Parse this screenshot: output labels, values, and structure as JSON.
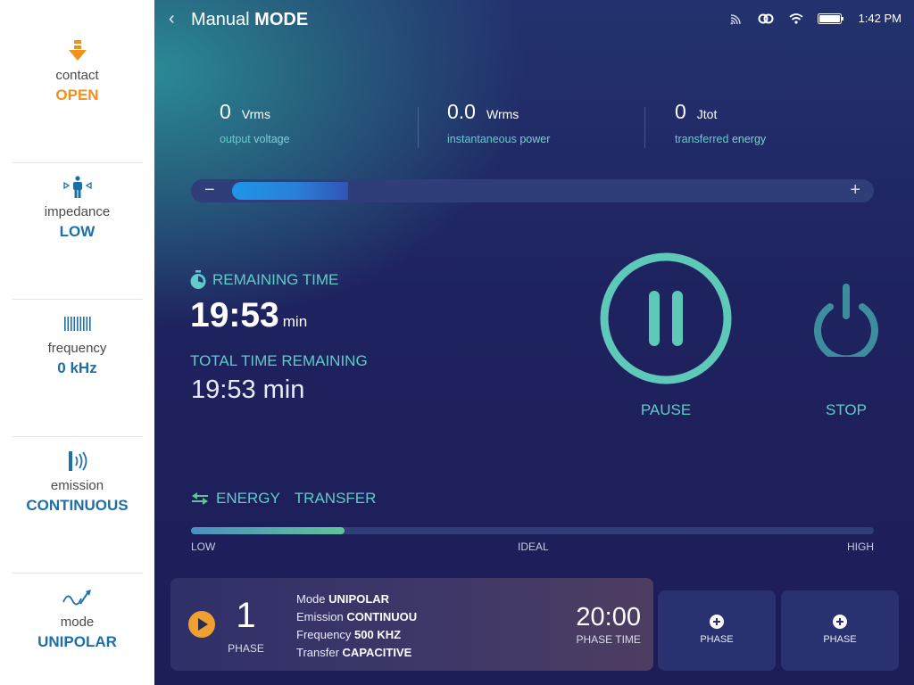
{
  "sidebar": {
    "items": [
      {
        "label": "contact",
        "value": "OPEN",
        "icon": "arrow-down-icon",
        "color": "#f0901e"
      },
      {
        "label": "impedance",
        "value": "LOW",
        "icon": "person-arrows-icon",
        "color": "#1d6fa8"
      },
      {
        "label": "frequency",
        "value": "0 kHz",
        "icon": "barcode-icon",
        "color": "#1d6fa8"
      },
      {
        "label": "emission",
        "value": "CONTINUOUS",
        "icon": "emission-waves-icon",
        "color": "#1d6fa8"
      },
      {
        "label": "mode",
        "value": "UNIPOLAR",
        "icon": "unipolar-wave-icon",
        "color": "#1d6fa8"
      }
    ]
  },
  "header": {
    "title_light": "Manual",
    "title_bold": "MODE",
    "time": "1:42 PM",
    "status_icons": [
      "cast-icon",
      "link-icon",
      "wifi-icon",
      "battery-icon"
    ]
  },
  "metrics": [
    {
      "value": "0",
      "unit": "Vrms",
      "sub_bold": "output",
      "sub_rest": "voltage"
    },
    {
      "value": "0.0",
      "unit": "Wrms",
      "sub_bold": "instantaneous",
      "sub_rest": "power"
    },
    {
      "value": "0",
      "unit": "Jtot",
      "sub_bold": "transferred",
      "sub_rest": "energy"
    }
  ],
  "power_slider": {
    "minus": "−",
    "plus": "+",
    "level": 0.17
  },
  "timer": {
    "remaining_label": "REMAINING TIME",
    "remaining_value": "19:53",
    "remaining_unit": "min",
    "total_label": "TOTAL TIME REMAINING",
    "total_value": "19:53 min"
  },
  "controls": {
    "pause_label": "PAUSE",
    "stop_label": "STOP"
  },
  "energy": {
    "label_1": "ENERGY",
    "label_2": "TRANSFER",
    "level": 0.225,
    "ticks": {
      "low": "LOW",
      "ideal": "IDEAL",
      "high": "HIGH"
    }
  },
  "phase": {
    "number": "1",
    "label": "PHASE",
    "mode_label": "Mode",
    "mode_value": "UNIPOLAR",
    "emission_label": "Emission",
    "emission_value": "CONTINUOU",
    "frequency_label": "Frequency",
    "frequency_value": "500 KHZ",
    "transfer_label": "Transfer",
    "transfer_value": "CAPACITIVE",
    "time": "20:00",
    "time_label": "PHASE TIME"
  },
  "add_phase": [
    {
      "label": "PHASE"
    },
    {
      "label": "PHASE"
    }
  ],
  "colors": {
    "accent_teal": "#60cbc8",
    "orange": "#f0901e",
    "blue_value": "#1d6fa8"
  }
}
